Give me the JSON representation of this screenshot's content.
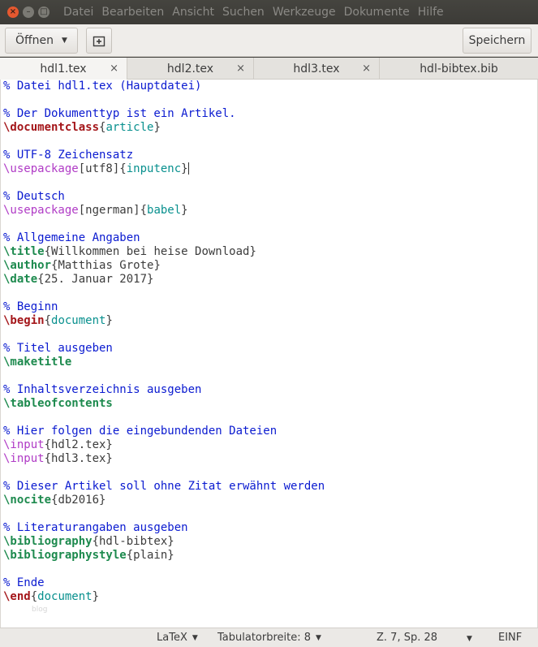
{
  "menubar": {
    "items": [
      "Datei",
      "Bearbeiten",
      "Ansicht",
      "Suchen",
      "Werkzeuge",
      "Dokumente",
      "Hilfe"
    ],
    "close_glyph": "×",
    "minimize_glyph": "–",
    "maximize_glyph": "□"
  },
  "toolbar": {
    "open_label": "Öffnen",
    "open_arrow": "▼",
    "new_tab_icon": "new-document-icon",
    "new_tab_glyph": "⊞",
    "save_label": "Speichern"
  },
  "tabs": [
    {
      "label": "hdl1.tex",
      "close": "×",
      "active": true
    },
    {
      "label": "hdl2.tex",
      "close": "×",
      "active": false
    },
    {
      "label": "hdl3.tex",
      "close": "×",
      "active": false
    },
    {
      "label": "hdl-bibtex.bib",
      "close": "",
      "active": false
    }
  ],
  "editor": {
    "lines": [
      {
        "segments": [
          {
            "t": "% Datei hdl1.tex (Hauptdatei)",
            "c": "comment"
          }
        ]
      },
      {
        "segments": []
      },
      {
        "segments": [
          {
            "t": "% Der Dokumenttyp ist ein Artikel.",
            "c": "comment"
          }
        ]
      },
      {
        "segments": [
          {
            "t": "\\documentclass",
            "c": "cmd-bold"
          },
          {
            "t": "{",
            "c": "brace"
          },
          {
            "t": "article",
            "c": "arg-teal"
          },
          {
            "t": "}",
            "c": "brace"
          }
        ]
      },
      {
        "segments": []
      },
      {
        "segments": [
          {
            "t": "% UTF-8 Zeichensatz",
            "c": "comment"
          }
        ]
      },
      {
        "segments": [
          {
            "t": "\\usepackage",
            "c": "cmd-purple"
          },
          {
            "t": "[utf8]{",
            "c": "brace"
          },
          {
            "t": "inputenc",
            "c": "arg-teal"
          },
          {
            "t": "}",
            "c": "brace"
          }
        ],
        "cursor": true
      },
      {
        "segments": []
      },
      {
        "segments": [
          {
            "t": "% Deutsch",
            "c": "comment"
          }
        ]
      },
      {
        "segments": [
          {
            "t": "\\usepackage",
            "c": "cmd-purple"
          },
          {
            "t": "[ngerman]{",
            "c": "brace"
          },
          {
            "t": "babel",
            "c": "arg-teal"
          },
          {
            "t": "}",
            "c": "brace"
          }
        ]
      },
      {
        "segments": []
      },
      {
        "segments": [
          {
            "t": "% Allgemeine Angaben",
            "c": "comment"
          }
        ]
      },
      {
        "segments": [
          {
            "t": "\\title",
            "c": "cmd-green"
          },
          {
            "t": "{Willkommen bei heise Download}",
            "c": "plain"
          }
        ]
      },
      {
        "segments": [
          {
            "t": "\\author",
            "c": "cmd-green"
          },
          {
            "t": "{Matthias Grote}",
            "c": "plain"
          }
        ]
      },
      {
        "segments": [
          {
            "t": "\\date",
            "c": "cmd-green"
          },
          {
            "t": "{25. Januar 2017}",
            "c": "plain"
          }
        ]
      },
      {
        "segments": []
      },
      {
        "segments": [
          {
            "t": "% Beginn",
            "c": "comment"
          }
        ]
      },
      {
        "segments": [
          {
            "t": "\\begin",
            "c": "cmd-bold"
          },
          {
            "t": "{",
            "c": "brace"
          },
          {
            "t": "document",
            "c": "arg-teal"
          },
          {
            "t": "}",
            "c": "brace"
          }
        ]
      },
      {
        "segments": []
      },
      {
        "segments": [
          {
            "t": "% Titel ausgeben",
            "c": "comment"
          }
        ]
      },
      {
        "segments": [
          {
            "t": "\\maketitle",
            "c": "cmd-green"
          }
        ]
      },
      {
        "segments": []
      },
      {
        "segments": [
          {
            "t": "% Inhaltsverzeichnis ausgeben",
            "c": "comment"
          }
        ]
      },
      {
        "segments": [
          {
            "t": "\\tableofcontents",
            "c": "cmd-green"
          }
        ]
      },
      {
        "segments": []
      },
      {
        "segments": [
          {
            "t": "% Hier folgen die eingebundenden Dateien",
            "c": "comment"
          }
        ]
      },
      {
        "segments": [
          {
            "t": "\\input",
            "c": "cmd-purple"
          },
          {
            "t": "{hdl2.tex}",
            "c": "plain"
          }
        ]
      },
      {
        "segments": [
          {
            "t": "\\input",
            "c": "cmd-purple"
          },
          {
            "t": "{hdl3.tex}",
            "c": "plain"
          }
        ]
      },
      {
        "segments": []
      },
      {
        "segments": [
          {
            "t": "% Dieser Artikel soll ohne Zitat erwähnt werden",
            "c": "comment"
          }
        ]
      },
      {
        "segments": [
          {
            "t": "\\nocite",
            "c": "cmd-green"
          },
          {
            "t": "{db2016}",
            "c": "plain"
          }
        ]
      },
      {
        "segments": []
      },
      {
        "segments": [
          {
            "t": "% Literaturangaben ausgeben",
            "c": "comment"
          }
        ]
      },
      {
        "segments": [
          {
            "t": "\\bibliography",
            "c": "cmd-green"
          },
          {
            "t": "{hdl-bibtex}",
            "c": "plain"
          }
        ]
      },
      {
        "segments": [
          {
            "t": "\\bibliographystyle",
            "c": "cmd-green"
          },
          {
            "t": "{plain}",
            "c": "plain"
          }
        ]
      },
      {
        "segments": []
      },
      {
        "segments": [
          {
            "t": "% Ende",
            "c": "comment"
          }
        ]
      },
      {
        "segments": [
          {
            "t": "\\end",
            "c": "cmd-bold"
          },
          {
            "t": "{",
            "c": "brace"
          },
          {
            "t": "document",
            "c": "arg-teal"
          },
          {
            "t": "}",
            "c": "brace"
          }
        ]
      }
    ],
    "watermark": "blog"
  },
  "statusbar": {
    "language": "LaTeX",
    "language_arrow": "▼",
    "tab_width": "Tabulatorbreite: 8",
    "tab_width_arrow": "▼",
    "position": "Z. 7, Sp. 28",
    "position_arrow": "▼",
    "insert_mode": "EINF"
  },
  "colors": {
    "comment": "#0a1ad0",
    "keyword_red": "#a4161a",
    "keyword_green": "#1d8a4e",
    "keyword_purple": "#b03bc6",
    "argument_teal": "#08908e",
    "menubar_bg": "#3c3b37",
    "close_button": "#e5582f"
  }
}
